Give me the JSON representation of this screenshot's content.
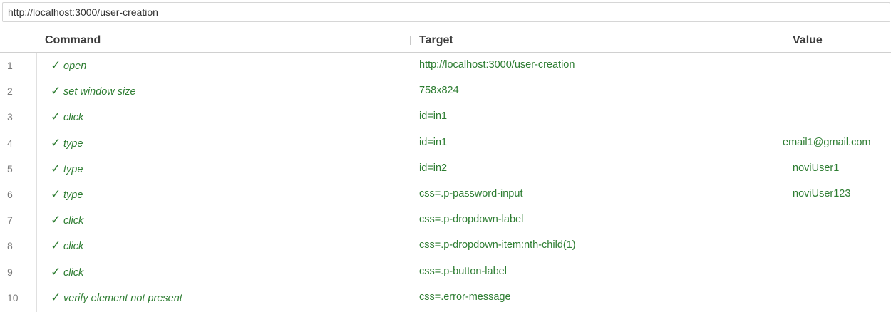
{
  "url_bar": {
    "value": "http://localhost:3000/user-creation"
  },
  "table": {
    "headers": {
      "command": "Command",
      "target": "Target",
      "value": "Value"
    },
    "rows": [
      {
        "num": "1",
        "status": "✓",
        "command": "open",
        "target": "http://localhost:3000/user-creation",
        "value": ""
      },
      {
        "num": "2",
        "status": "✓",
        "command": "set window size",
        "target": "758x824",
        "value": ""
      },
      {
        "num": "3",
        "status": "✓",
        "command": "click",
        "target": "id=in1",
        "value": ""
      },
      {
        "num": "4",
        "status": "✓",
        "command": "type",
        "target": "id=in1",
        "value": "email1@gmail.com"
      },
      {
        "num": "5",
        "status": "✓",
        "command": "type",
        "target": "id=in2",
        "value": "noviUser1"
      },
      {
        "num": "6",
        "status": "✓",
        "command": "type",
        "target": "css=.p-password-input",
        "value": "noviUser123"
      },
      {
        "num": "7",
        "status": "✓",
        "command": "click",
        "target": "css=.p-dropdown-label",
        "value": ""
      },
      {
        "num": "8",
        "status": "✓",
        "command": "click",
        "target": "css=.p-dropdown-item:nth-child(1)",
        "value": ""
      },
      {
        "num": "9",
        "status": "✓",
        "command": "click",
        "target": "css=.p-button-label",
        "value": ""
      },
      {
        "num": "10",
        "status": "✓",
        "command": "verify element not present",
        "target": "css=.error-message",
        "value": ""
      }
    ]
  },
  "colors": {
    "success_text": "#2e7d32",
    "row_number": "#7a7a7a",
    "header_text": "#3c3c3c"
  },
  "icons": {
    "status": "check-icon"
  }
}
